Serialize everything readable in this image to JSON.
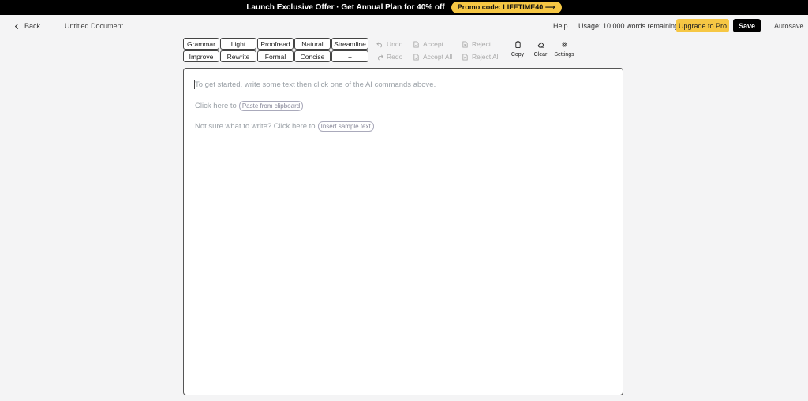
{
  "promo": {
    "text": "Launch Exclusive Offer · Get Annual Plan for 40% off",
    "code": "Promo code: LIFETIME40 ⟶"
  },
  "header": {
    "back_label": "Back",
    "doc_title": "Untitled Document",
    "help": "Help",
    "usage": "Usage: 10 000 words remaining",
    "upgrade": "Upgrade to Pro",
    "save": "Save",
    "autosave": "Autosave"
  },
  "commands": [
    "Grammar",
    "Light",
    "Proofread",
    "Natural",
    "Streamline",
    "Improve",
    "Rewrite",
    "Formal",
    "Concise",
    "+"
  ],
  "history": {
    "undo": "Undo",
    "redo": "Redo",
    "accept": "Accept",
    "accept_all": "Accept All",
    "reject": "Reject",
    "reject_all": "Reject All"
  },
  "tools": {
    "copy": "Copy",
    "clear": "Clear",
    "settings": "Settings"
  },
  "editor": {
    "placeholder": "To get started, write some text then click one of the AI commands above.",
    "paste_prompt": "Click here to",
    "paste_button": "Paste from clipboard",
    "sample_prompt": "Not sure what to write? Click here to",
    "sample_button": "Insert sample text"
  },
  "colors": {
    "accent_yellow": "#f6c744",
    "banner_bg": "#000000"
  }
}
